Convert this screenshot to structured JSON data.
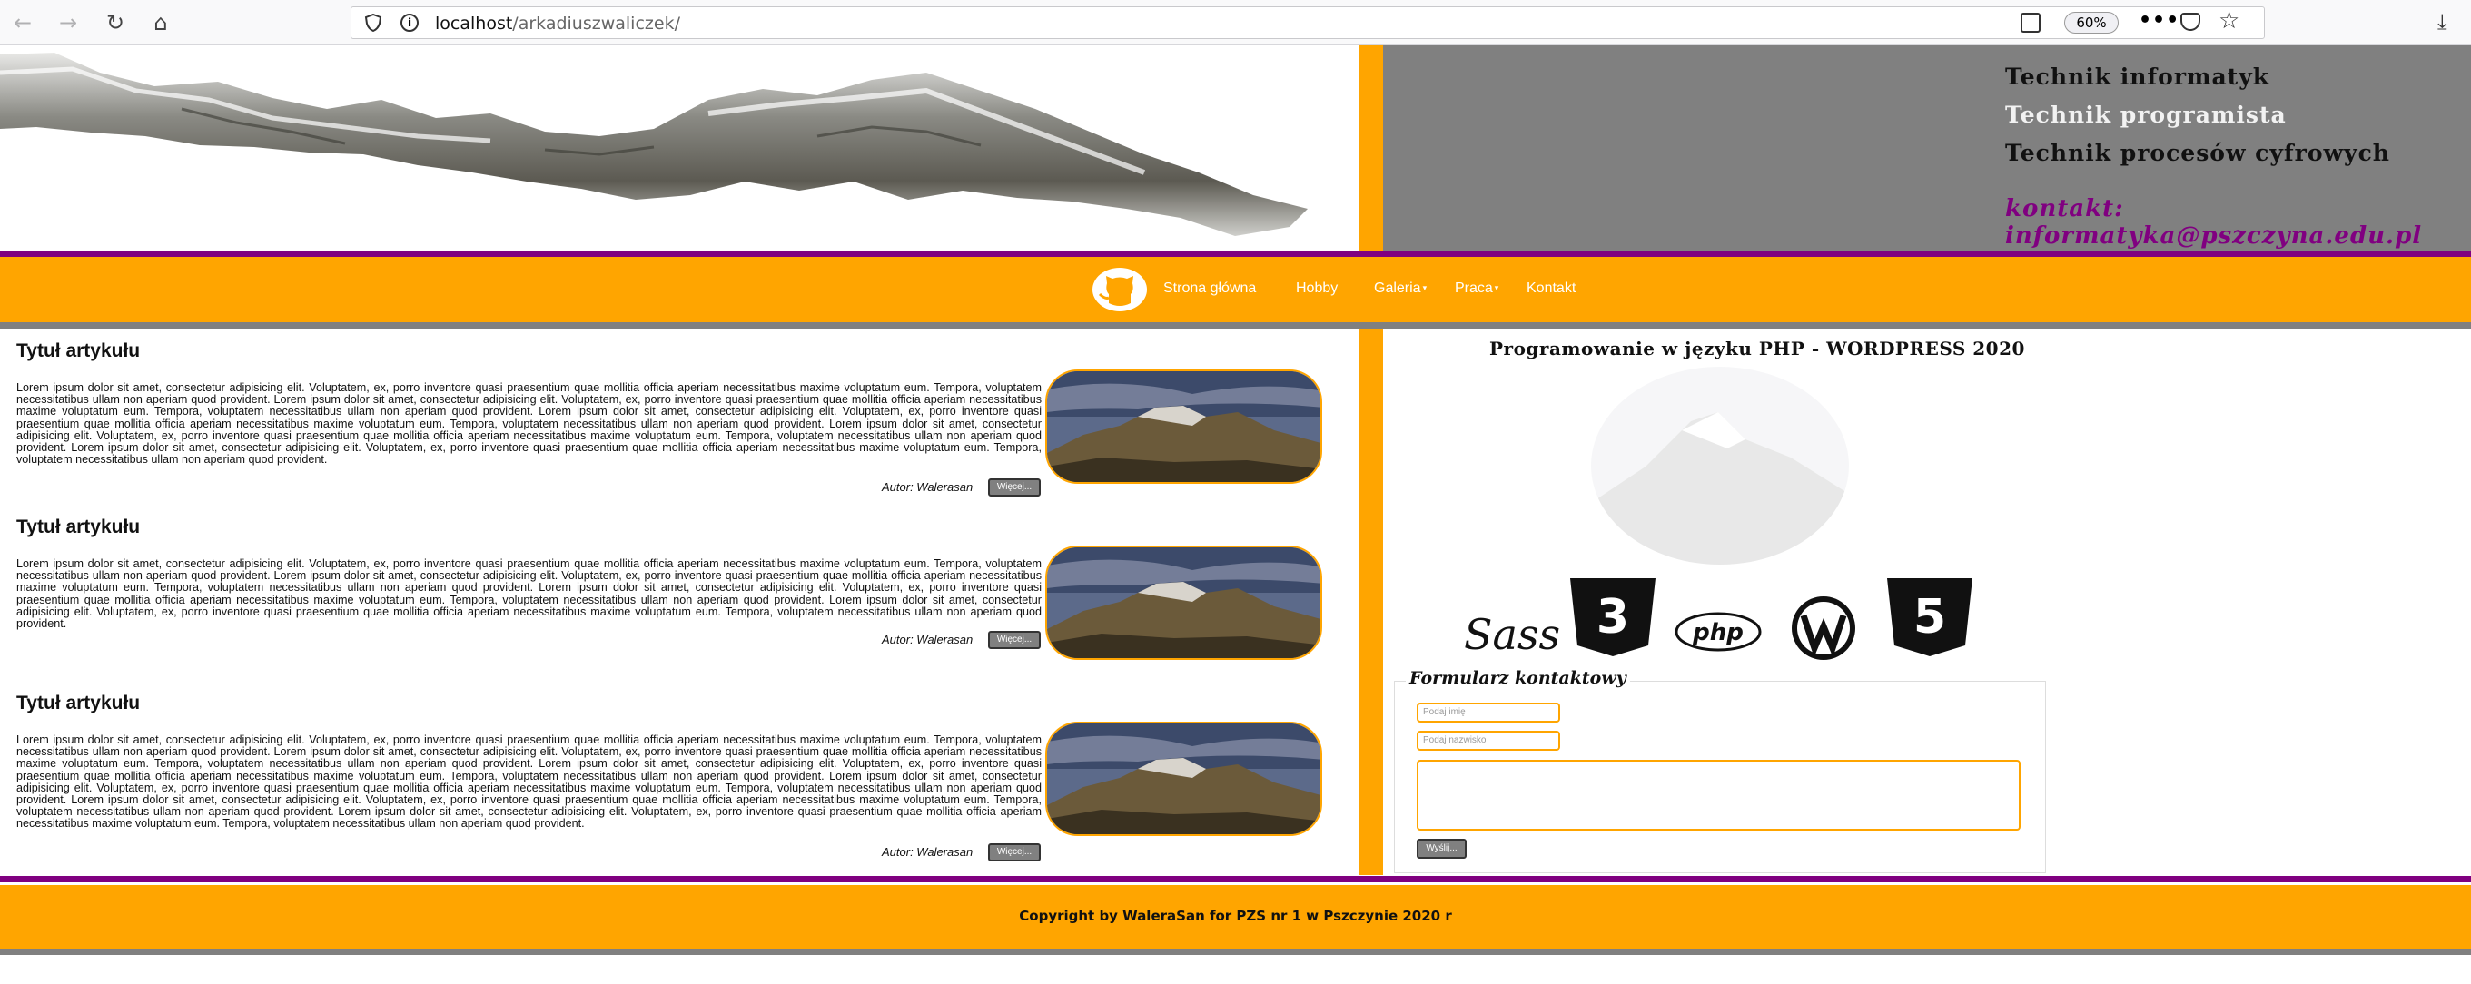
{
  "browser": {
    "url_host": "localhost",
    "url_path": "/arkadiuszwaliczek/",
    "zoom": "60%",
    "dots": "•••"
  },
  "header": {
    "line1": "Technik informatyk",
    "line2": "Technik programista",
    "line3": "Technik procesów cyfrowych",
    "contact": "kontakt: informatyka@pszczyna.edu.pl"
  },
  "nav": {
    "items": [
      "Strona główna",
      "Hobby",
      "Galeria",
      "Praca",
      "Kontakt"
    ]
  },
  "articles": [
    {
      "title": "Tytuł artykułu",
      "body": "Lorem ipsum dolor sit amet, consectetur adipisicing elit. Voluptatem, ex, porro inventore quasi praesentium quae mollitia officia aperiam necessitatibus maxime voluptatum eum. Tempora, voluptatem necessitatibus ullam non aperiam quod provident. Lorem ipsum dolor sit amet, consectetur adipisicing elit. Voluptatem, ex, porro inventore quasi praesentium quae mollitia officia aperiam necessitatibus maxime voluptatum eum. Tempora, voluptatem necessitatibus ullam non aperiam quod provident. Lorem ipsum dolor sit amet, consectetur adipisicing elit. Voluptatem, ex, porro inventore quasi praesentium quae mollitia officia aperiam necessitatibus maxime voluptatum eum. Tempora, voluptatem necessitatibus ullam non aperiam quod provident. Lorem ipsum dolor sit amet, consectetur adipisicing elit. Voluptatem, ex, porro inventore quasi praesentium quae mollitia officia aperiam necessitatibus maxime voluptatum eum. Tempora, voluptatem necessitatibus ullam non aperiam quod provident. Lorem ipsum dolor sit amet, consectetur adipisicing elit. Voluptatem, ex, porro inventore quasi praesentium quae mollitia officia aperiam necessitatibus maxime voluptatum eum. Tempora, voluptatem necessitatibus ullam non aperiam quod provident.",
      "author": "Autor: Walerasan",
      "more": "Więcej..."
    },
    {
      "title": "Tytuł artykułu",
      "body": "Lorem ipsum dolor sit amet, consectetur adipisicing elit. Voluptatem, ex, porro inventore quasi praesentium quae mollitia officia aperiam necessitatibus maxime voluptatum eum. Tempora, voluptatem necessitatibus ullam non aperiam quod provident. Lorem ipsum dolor sit amet, consectetur adipisicing elit. Voluptatem, ex, porro inventore quasi praesentium quae mollitia officia aperiam necessitatibus maxime voluptatum eum. Tempora, voluptatem necessitatibus ullam non aperiam quod provident. Lorem ipsum dolor sit amet, consectetur adipisicing elit. Voluptatem, ex, porro inventore quasi praesentium quae mollitia officia aperiam necessitatibus maxime voluptatum eum. Tempora, voluptatem necessitatibus ullam non aperiam quod provident. Lorem ipsum dolor sit amet, consectetur adipisicing elit. Voluptatem, ex, porro inventore quasi praesentium quae mollitia officia aperiam necessitatibus maxime voluptatum eum. Tempora, voluptatem necessitatibus ullam non aperiam quod provident.",
      "author": "Autor: Walerasan",
      "more": "Więcej..."
    },
    {
      "title": "Tytuł artykułu",
      "body": "Lorem ipsum dolor sit amet, consectetur adipisicing elit. Voluptatem, ex, porro inventore quasi praesentium quae mollitia officia aperiam necessitatibus maxime voluptatum eum. Tempora, voluptatem necessitatibus ullam non aperiam quod provident. Lorem ipsum dolor sit amet, consectetur adipisicing elit. Voluptatem, ex, porro inventore quasi praesentium quae mollitia officia aperiam necessitatibus maxime voluptatum eum. Tempora, voluptatem necessitatibus ullam non aperiam quod provident. Lorem ipsum dolor sit amet, consectetur adipisicing elit. Voluptatem, ex, porro inventore quasi praesentium quae mollitia officia aperiam necessitatibus maxime voluptatum eum. Tempora, voluptatem necessitatibus ullam non aperiam quod provident. Lorem ipsum dolor sit amet, consectetur adipisicing elit. Voluptatem, ex, porro inventore quasi praesentium quae mollitia officia aperiam necessitatibus maxime voluptatum eum. Tempora, voluptatem necessitatibus ullam non aperiam quod provident. Lorem ipsum dolor sit amet, consectetur adipisicing elit. Voluptatem, ex, porro inventore quasi praesentium quae mollitia officia aperiam necessitatibus maxime voluptatum eum. Tempora, voluptatem necessitatibus ullam non aperiam quod provident. Lorem ipsum dolor sit amet, consectetur adipisicing elit. Voluptatem, ex, porro inventore quasi praesentium quae mollitia officia aperiam necessitatibus maxime voluptatum eum. Tempora, voluptatem necessitatibus ullam non aperiam quod provident.",
      "author": "Autor: Walerasan",
      "more": "Więcej..."
    }
  ],
  "sidebar": {
    "title": "Programowanie w języku PHP - WORDPRESS 2020",
    "logos": [
      "Sass",
      "CSS3",
      "php",
      "WordPress",
      "HTML5"
    ],
    "sass_text": "Sass",
    "php_text": "php",
    "css_number": "3",
    "html_number": "5"
  },
  "form": {
    "legend": "Formularz kontaktowy",
    "name_placeholder": "Podaj imię",
    "surname_placeholder": "Podaj nazwisko",
    "send_label": "Wyślij..."
  },
  "footer": {
    "text": "Copyright by WaleraSan for PZS nr 1 w Pszczynie 2020 r"
  },
  "colors": {
    "orange": "#ffa500",
    "purple": "#800080",
    "grey": "#808080"
  }
}
